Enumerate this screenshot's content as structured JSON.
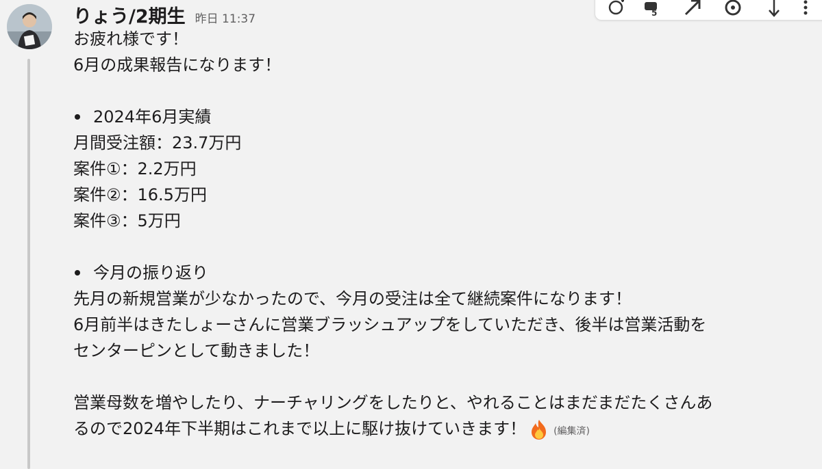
{
  "message": {
    "author": "りょう/2期生",
    "timestamp": "昨日 11:37",
    "lines_intro": [
      "お疲れ様です！",
      "6月の成果報告になります！"
    ],
    "section1_title": "2024年6月実績",
    "section1_lines": [
      "月間受注額：23.7万円",
      "案件①：2.2万円",
      "案件②：16.5万円",
      "案件③：5万円"
    ],
    "section2_title": "今月の振り返り",
    "section2_lines": [
      "先月の新規営業が少なかったので、今月の受注は全て継続案件になります！",
      "6月前半はきたしょーさんに営業ブラッシュアップをしていただき、後半は営業活動を",
      "センターピンとして動きました！"
    ],
    "closing_lines": [
      "営業母数を増やしたり、ナーチャリングをしたりと、やれることはまだまだたくさんあ",
      "るので2024年下半期はこれまで以上に駆け抜けていきます！"
    ],
    "emoji": "fire-icon",
    "edited_label": "(編集済)"
  },
  "toolbar": {
    "icons": [
      "add-reaction-icon",
      "reply-thread-icon",
      "share-icon",
      "bookmark-icon",
      "more-icon"
    ]
  },
  "colors": {
    "background": "#f2f2f2",
    "text": "#1d1c1d",
    "muted": "#616061",
    "thread_line": "#c8c8c8"
  }
}
